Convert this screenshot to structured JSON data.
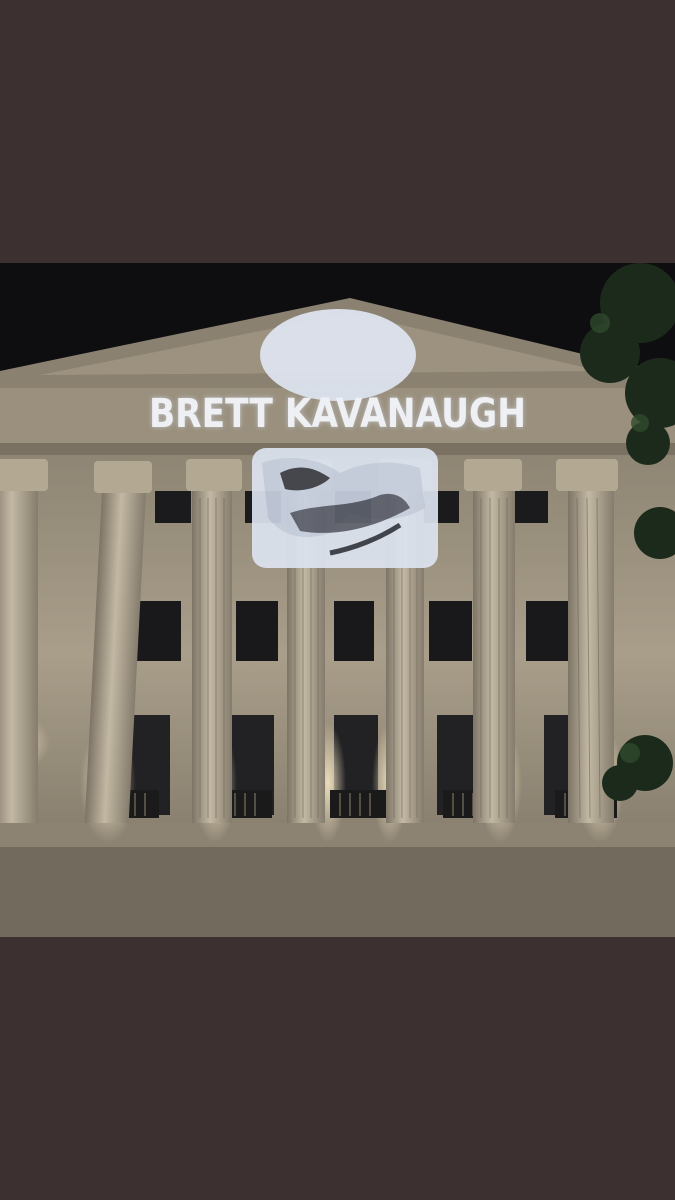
{
  "background_color": "#3d3030",
  "photo": {
    "subject": "building-facade-at-night-with-projection",
    "projected_text": "BRETT KAVANAUGH",
    "colors": {
      "sky": "#0e0e10",
      "stone": "#a99f8c",
      "stone_shadow": "#6f675a",
      "window": "#1c1c1e",
      "projection": "#dfe6f2",
      "foliage": "#1d2a1c"
    }
  }
}
